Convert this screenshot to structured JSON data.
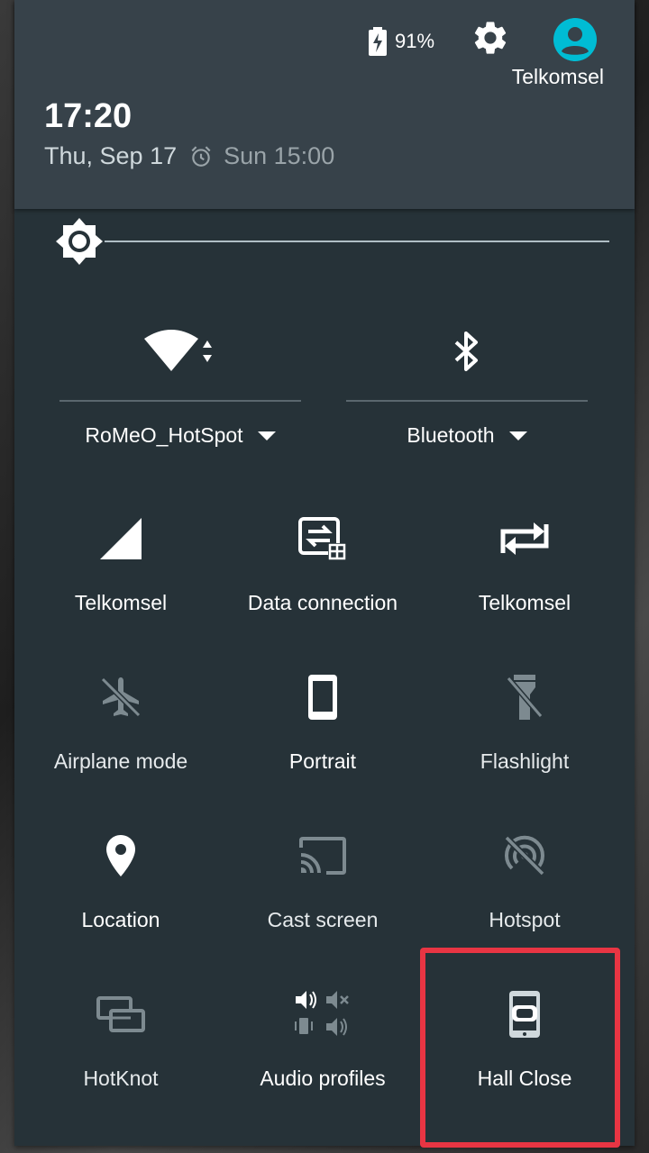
{
  "status": {
    "battery_percent": "91%",
    "carrier": "Telkomsel",
    "time": "17:20",
    "date": "Thu, Sep 17",
    "next_alarm": "Sun 15:00"
  },
  "brightness": {
    "level": 0.0
  },
  "big_tiles": {
    "wifi": {
      "label": "RoMeO_HotSpot",
      "icon": "wifi-icon"
    },
    "bluetooth": {
      "label": "Bluetooth",
      "icon": "bluetooth-icon"
    }
  },
  "tiles": {
    "cellular_label": "Telkomsel",
    "data_label": "Data connection",
    "roaming_label": "Telkomsel",
    "airplane_label": "Airplane mode",
    "rotation_label": "Portrait",
    "flashlight_label": "Flashlight",
    "location_label": "Location",
    "cast_label": "Cast screen",
    "hotspot_label": "Hotspot",
    "hotknot_label": "HotKnot",
    "audio_label": "Audio profiles",
    "hall_label": "Hall Close"
  },
  "colors": {
    "shade_bg": "#263238",
    "header_bg": "#37424a",
    "accent_user": "#00bcd4",
    "highlight": "#e83543"
  }
}
